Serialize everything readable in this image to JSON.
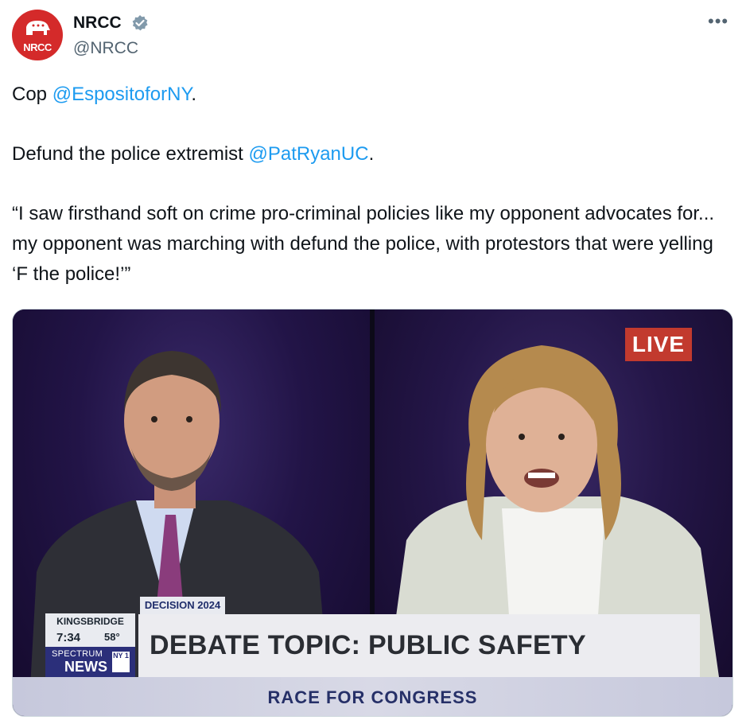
{
  "author": {
    "name": "NRCC",
    "handle": "@NRCC",
    "avatar_text": "NRCC",
    "verified": true
  },
  "more_label": "•••",
  "tweet": {
    "line1_prefix": "Cop ",
    "mention1": "@EspositoforNY",
    "line1_suffix": ".",
    "line2_prefix": "Defund the police extremist ",
    "mention2": "@PatRyanUC",
    "line2_suffix": ".",
    "quote": "“I saw firsthand soft on crime pro-criminal policies like my opponent advocates for... my opponent was marching with defund the police, with protestors that were yelling ‘F the police!’”"
  },
  "video": {
    "live_label": "LIVE",
    "decision_label": "DECISION 2024",
    "location": "KINGSBRIDGE",
    "time": "7:34",
    "temperature": "58°",
    "network_top": "SPECTRUM",
    "network_bottom": "NEWS",
    "channel": "NY 1",
    "topic": "DEBATE TOPIC: PUBLIC SAFETY",
    "banner": "RACE FOR CONGRESS"
  },
  "colors": {
    "accent": "#1d9bf0",
    "brand": "#d42a2a",
    "live_red": "#c23a2e",
    "spectrum_blue": "#2b2f7a"
  }
}
